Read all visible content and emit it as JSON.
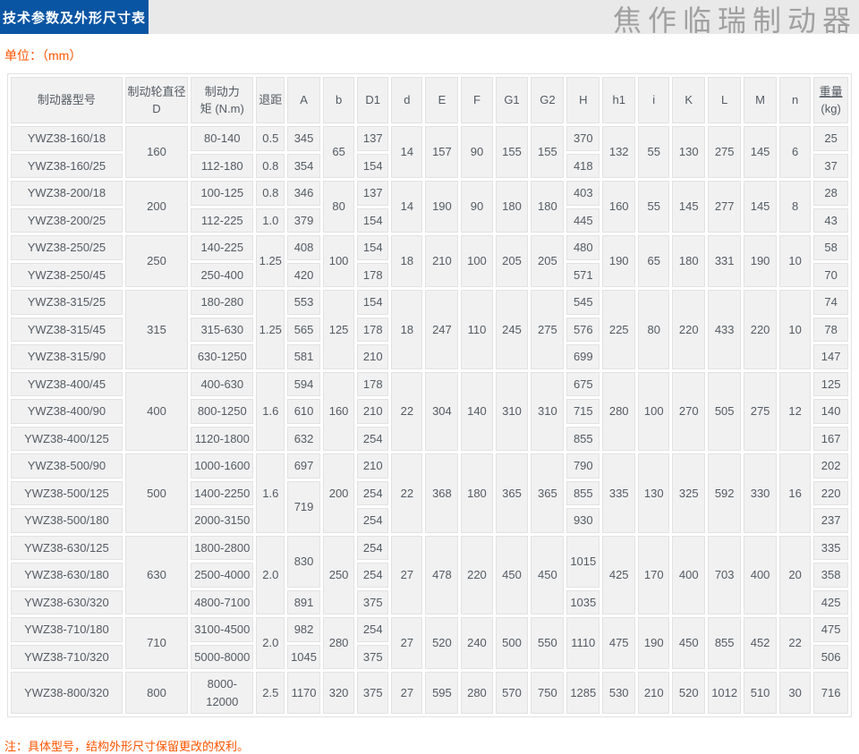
{
  "header": {
    "title": "技术参数及外形尺寸表",
    "watermark": "焦作临瑞制动器",
    "unit_label": "单位：（mm）"
  },
  "footer": {
    "note": "注：具体型号，结构外形尺寸保留更改的权利。"
  },
  "colors": {
    "tab_blue": "#0a55a3",
    "accent_orange": "#ff5400",
    "band_gray": "#e9e9e9",
    "cell_bg": "#f1f1f1",
    "cell_border": "#e2e2e2",
    "cell_text": "#545b63",
    "watermark_gray": "#a0a0a0"
  },
  "table": {
    "col_widths": [
      "14.2%",
      "8%",
      "8%",
      "3.6%",
      "4.2%",
      "4.0%",
      "4.0%",
      "4.0%",
      "4.2%",
      "4.0%",
      "4.2%",
      "4.2%",
      "4.2%",
      "4.2%",
      "4.0%",
      "4.2%",
      "4.2%",
      "4.2%",
      "4.0%",
      "4.4%"
    ],
    "headers": [
      {
        "t": "制动器型号"
      },
      {
        "t": "制动轮直径 D"
      },
      {
        "t": "制动力\n矩 (N.m)"
      },
      {
        "t": "退距"
      },
      {
        "t": "A"
      },
      {
        "t": "b"
      },
      {
        "t": "D1"
      },
      {
        "t": "d"
      },
      {
        "t": "E"
      },
      {
        "t": "F"
      },
      {
        "t": "G1"
      },
      {
        "t": "G2"
      },
      {
        "t": "H"
      },
      {
        "t": "h1"
      },
      {
        "t": "i"
      },
      {
        "t": "K"
      },
      {
        "t": "L"
      },
      {
        "t": "M"
      },
      {
        "t": "n"
      },
      {
        "t": "重量\n(kg)",
        "u": true
      }
    ],
    "rows": [
      [
        "YWZ38-160/18",
        {
          "t": "160",
          "rs": 2
        },
        "80-140",
        "0.5",
        "345",
        {
          "t": "65",
          "rs": 2
        },
        "137",
        {
          "t": "14",
          "rs": 2
        },
        {
          "t": "157",
          "rs": 2
        },
        {
          "t": "90",
          "rs": 2
        },
        {
          "t": "155",
          "rs": 2
        },
        {
          "t": "155",
          "rs": 2
        },
        "370",
        {
          "t": "132",
          "rs": 2
        },
        {
          "t": "55",
          "rs": 2
        },
        {
          "t": "130",
          "rs": 2
        },
        {
          "t": "275",
          "rs": 2
        },
        {
          "t": "145",
          "rs": 2
        },
        {
          "t": "6",
          "rs": 2
        },
        "25"
      ],
      [
        "YWZ38-160/25",
        "112-180",
        "0.8",
        "354",
        "154",
        "418",
        "37"
      ],
      [
        "YWZ38-200/18",
        {
          "t": "200",
          "rs": 2
        },
        "100-125",
        "0.8",
        "346",
        {
          "t": "80",
          "rs": 2
        },
        "137",
        {
          "t": "14",
          "rs": 2
        },
        {
          "t": "190",
          "rs": 2
        },
        {
          "t": "90",
          "rs": 2
        },
        {
          "t": "180",
          "rs": 2
        },
        {
          "t": "180",
          "rs": 2
        },
        "403",
        {
          "t": "160",
          "rs": 2
        },
        {
          "t": "55",
          "rs": 2
        },
        {
          "t": "145",
          "rs": 2
        },
        {
          "t": "277",
          "rs": 2
        },
        {
          "t": "145",
          "rs": 2
        },
        {
          "t": "8",
          "rs": 2
        },
        "28"
      ],
      [
        "YWZ38-200/25",
        "112-225",
        "1.0",
        "379",
        "154",
        "445",
        "43"
      ],
      [
        "YWZ38-250/25",
        {
          "t": "250",
          "rs": 2
        },
        "140-225",
        {
          "t": "1.25",
          "rs": 2
        },
        "408",
        {
          "t": "100",
          "rs": 2
        },
        "154",
        {
          "t": "18",
          "rs": 2
        },
        {
          "t": "210",
          "rs": 2
        },
        {
          "t": "100",
          "rs": 2
        },
        {
          "t": "205",
          "rs": 2
        },
        {
          "t": "205",
          "rs": 2
        },
        "480",
        {
          "t": "190",
          "rs": 2
        },
        {
          "t": "65",
          "rs": 2
        },
        {
          "t": "180",
          "rs": 2
        },
        {
          "t": "331",
          "rs": 2
        },
        {
          "t": "190",
          "rs": 2
        },
        {
          "t": "10",
          "rs": 2
        },
        "58"
      ],
      [
        "YWZ38-250/45",
        "250-400",
        "420",
        "178",
        "571",
        "70"
      ],
      [
        "YWZ38-315/25",
        {
          "t": "315",
          "rs": 3
        },
        "180-280",
        {
          "t": "1.25",
          "rs": 3
        },
        "553",
        {
          "t": "125",
          "rs": 3
        },
        "154",
        {
          "t": "18",
          "rs": 3
        },
        {
          "t": "247",
          "rs": 3
        },
        {
          "t": "110",
          "rs": 3
        },
        {
          "t": "245",
          "rs": 3
        },
        {
          "t": "275",
          "rs": 3
        },
        "545",
        {
          "t": "225",
          "rs": 3
        },
        {
          "t": "80",
          "rs": 3
        },
        {
          "t": "220",
          "rs": 3
        },
        {
          "t": "433",
          "rs": 3
        },
        {
          "t": "220",
          "rs": 3
        },
        {
          "t": "10",
          "rs": 3
        },
        "74"
      ],
      [
        "YWZ38-315/45",
        "315-630",
        "565",
        "178",
        "576",
        "78"
      ],
      [
        "YWZ38-315/90",
        "630-1250",
        "581",
        "210",
        "699",
        "147"
      ],
      [
        "YWZ38-400/45",
        {
          "t": "400",
          "rs": 3
        },
        "400-630",
        {
          "t": "1.6",
          "rs": 3
        },
        "594",
        {
          "t": "160",
          "rs": 3
        },
        "178",
        {
          "t": "22",
          "rs": 3
        },
        {
          "t": "304",
          "rs": 3
        },
        {
          "t": "140",
          "rs": 3
        },
        {
          "t": "310",
          "rs": 3
        },
        {
          "t": "310",
          "rs": 3
        },
        "675",
        {
          "t": "280",
          "rs": 3
        },
        {
          "t": "100",
          "rs": 3
        },
        {
          "t": "270",
          "rs": 3
        },
        {
          "t": "505",
          "rs": 3
        },
        {
          "t": "275",
          "rs": 3
        },
        {
          "t": "12",
          "rs": 3
        },
        "125"
      ],
      [
        "YWZ38-400/90",
        "800-1250",
        "610",
        "210",
        "715",
        "140"
      ],
      [
        "YWZ38-400/125",
        "1120-1800",
        "632",
        "254",
        "855",
        "167"
      ],
      [
        "YWZ38-500/90",
        {
          "t": "500",
          "rs": 3
        },
        "1000-1600",
        {
          "t": "1.6",
          "rs": 3
        },
        "697",
        {
          "t": "200",
          "rs": 3
        },
        "210",
        {
          "t": "22",
          "rs": 3
        },
        {
          "t": "368",
          "rs": 3
        },
        {
          "t": "180",
          "rs": 3
        },
        {
          "t": "365",
          "rs": 3
        },
        {
          "t": "365",
          "rs": 3
        },
        "790",
        {
          "t": "335",
          "rs": 3
        },
        {
          "t": "130",
          "rs": 3
        },
        {
          "t": "325",
          "rs": 3
        },
        {
          "t": "592",
          "rs": 3
        },
        {
          "t": "330",
          "rs": 3
        },
        {
          "t": "16",
          "rs": 3
        },
        "202"
      ],
      [
        "YWZ38-500/125",
        "1400-2250",
        {
          "t": "719",
          "rs": 2
        },
        "254",
        "855",
        "220"
      ],
      [
        "YWZ38-500/180",
        "2000-3150",
        "254",
        "930",
        "237"
      ],
      [
        "YWZ38-630/125",
        {
          "t": "630",
          "rs": 3
        },
        "1800-2800",
        {
          "t": "2.0",
          "rs": 3
        },
        {
          "t": "830",
          "rs": 2
        },
        {
          "t": "250",
          "rs": 3
        },
        "254",
        {
          "t": "27",
          "rs": 3
        },
        {
          "t": "478",
          "rs": 3
        },
        {
          "t": "220",
          "rs": 3
        },
        {
          "t": "450",
          "rs": 3
        },
        {
          "t": "450",
          "rs": 3
        },
        {
          "t": "1015",
          "rs": 2
        },
        {
          "t": "425",
          "rs": 3
        },
        {
          "t": "170",
          "rs": 3
        },
        {
          "t": "400",
          "rs": 3
        },
        {
          "t": "703",
          "rs": 3
        },
        {
          "t": "400",
          "rs": 3
        },
        {
          "t": "20",
          "rs": 3
        },
        "335"
      ],
      [
        "YWZ38-630/180",
        "2500-4000",
        "254",
        "358"
      ],
      [
        "YWZ38-630/320",
        "4800-7100",
        "891",
        "375",
        "1035",
        "425"
      ],
      [
        "YWZ38-710/180",
        {
          "t": "710",
          "rs": 2
        },
        "3100-4500",
        {
          "t": "2.0",
          "rs": 2
        },
        "982",
        {
          "t": "280",
          "rs": 2
        },
        "254",
        {
          "t": "27",
          "rs": 2
        },
        {
          "t": "520",
          "rs": 2
        },
        {
          "t": "240",
          "rs": 2
        },
        {
          "t": "500",
          "rs": 2
        },
        {
          "t": "550",
          "rs": 2
        },
        {
          "t": "1110",
          "rs": 2
        },
        {
          "t": "475",
          "rs": 2
        },
        {
          "t": "190",
          "rs": 2
        },
        {
          "t": "450",
          "rs": 2
        },
        {
          "t": "855",
          "rs": 2
        },
        {
          "t": "452",
          "rs": 2
        },
        {
          "t": "22",
          "rs": 2
        },
        "475"
      ],
      [
        "YWZ38-710/320",
        "5000-8000",
        "1045",
        "375",
        "506"
      ],
      [
        "YWZ38-800/320",
        "800",
        "8000-\n12000",
        "2.5",
        "1170",
        "320",
        "375",
        "27",
        "595",
        "280",
        "570",
        "750",
        "1285",
        "530",
        "210",
        "520",
        "1012",
        "510",
        "30",
        "716"
      ]
    ]
  }
}
